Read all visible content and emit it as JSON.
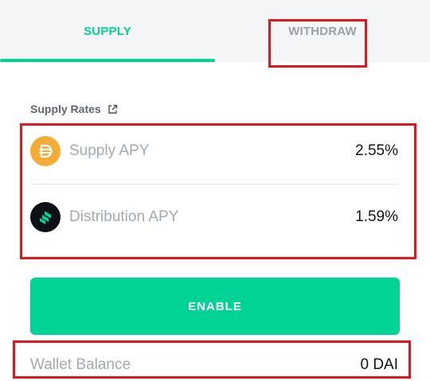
{
  "tabs": {
    "supply_label": "SUPPLY",
    "withdraw_label": "WITHDRAW",
    "active": "SUPPLY"
  },
  "supply_rates": {
    "title": "Supply Rates",
    "title_icon": "external-link-icon",
    "rows": [
      {
        "icon": "dai-coin-icon",
        "label": "Supply APY",
        "value": "2.55%"
      },
      {
        "icon": "comp-coin-icon",
        "label": "Distribution APY",
        "value": "1.59%"
      }
    ]
  },
  "actions": {
    "enable_label": "ENABLE"
  },
  "wallet": {
    "label": "Wallet Balance",
    "value": "0 DAI"
  },
  "colors": {
    "accent": "#00d395",
    "highlight": "#e8141d",
    "dai": "#f5ac37",
    "comp": "#0d1117"
  }
}
